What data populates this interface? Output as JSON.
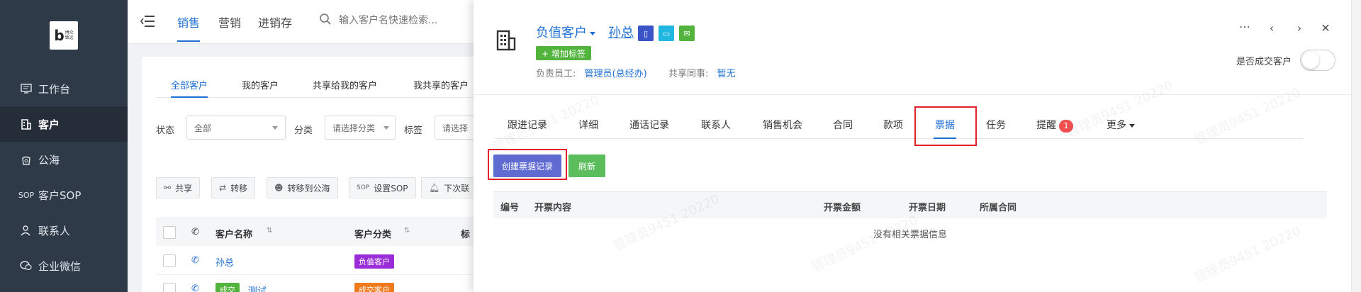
{
  "logo": {
    "mark": "b",
    "text_line1": "博众",
    "text_line2": "致远"
  },
  "sidebar": {
    "items": [
      {
        "label": "工作台",
        "icon": "monitor-icon"
      },
      {
        "label": "客户",
        "icon": "building-icon",
        "active": true
      },
      {
        "label": "公海",
        "icon": "bag-icon"
      },
      {
        "label": "客户SOP",
        "icon": "sop-icon"
      },
      {
        "label": "联系人",
        "icon": "person-icon"
      },
      {
        "label": "企业微信",
        "icon": "wechat-icon"
      }
    ]
  },
  "topbar": {
    "tabs": [
      "销售",
      "营销",
      "进销存"
    ],
    "active_tab": "销售",
    "search_placeholder": "输入客户名快速检索..."
  },
  "main": {
    "sub_tabs": [
      "全部客户",
      "我的客户",
      "共享给我的客户",
      "我共享的客户"
    ],
    "filters": {
      "status_label": "状态",
      "status_value": "全部",
      "category_label": "分类",
      "category_value": "请选择分类",
      "tag_label": "标签",
      "tag_value": "请选择"
    },
    "actions": [
      {
        "label": "共享",
        "icon": "share-icon"
      },
      {
        "label": "转移",
        "icon": "transfer-icon"
      },
      {
        "label": "转移到公海",
        "icon": "sea-icon"
      },
      {
        "label": "设置SOP",
        "icon": "sop-icon"
      },
      {
        "label": "下次联",
        "icon": "bell-icon"
      }
    ],
    "table": {
      "headers": [
        "客户名称",
        "客户分类",
        "标"
      ],
      "rows": [
        {
          "name": "孙总",
          "category": "负值客户",
          "category_color": "#9b2dd8"
        },
        {
          "name": "测试",
          "tag": "成交",
          "category": "成交客户",
          "category_color": "#f07b1c"
        }
      ]
    }
  },
  "drawer": {
    "customer_type": "负值客户",
    "customer_name": "孙总",
    "add_tag_label": "+ 增加标签",
    "owner_label": "负责员工:",
    "owner_value": "管理员(总经办)",
    "share_label": "共享同事:",
    "share_value": "暂无",
    "deal_label": "是否成交客户",
    "tabs": [
      {
        "label": "跟进记录"
      },
      {
        "label": "详细"
      },
      {
        "label": "通话记录"
      },
      {
        "label": "联系人"
      },
      {
        "label": "销售机会"
      },
      {
        "label": "合同"
      },
      {
        "label": "款项"
      },
      {
        "label": "票据",
        "active": true
      },
      {
        "label": "任务"
      },
      {
        "label": "提醒",
        "badge": "1"
      },
      {
        "label": "更多"
      }
    ],
    "create_button": "创建票据记录",
    "refresh_button": "刷新",
    "bill_table_headers": [
      "编号",
      "开票内容",
      "开票金额",
      "开票日期",
      "所属合同"
    ],
    "empty_text": "没有相关票据信息",
    "watermark": "管理员9451 20220"
  },
  "colors": {
    "accent": "#1d6fd6",
    "sidebar": "#2f3a48",
    "green": "#52b33d",
    "purple_btn": "#5f6bd1",
    "highlight": "#e0202a"
  }
}
